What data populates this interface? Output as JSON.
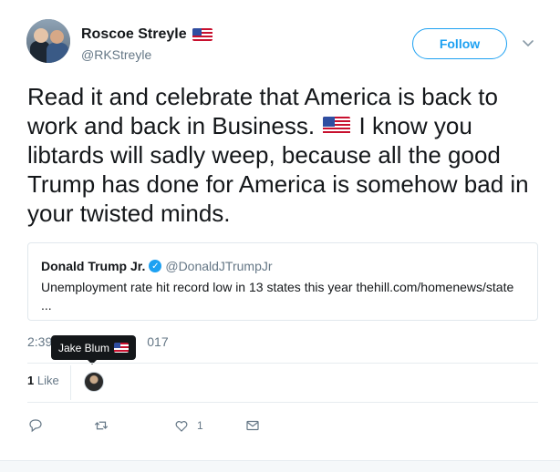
{
  "tweet": {
    "author": {
      "name": "Roscoe Streyle",
      "handle": "@RKStreyle",
      "name_emoji": "us-flag"
    },
    "follow_label": "Follow",
    "text": {
      "part1": "Read it and celebrate that America is back to work and back in Business.",
      "part2": "I know you libtards will sadly weep, because all the good Trump has done for America is somehow bad in your twisted minds."
    },
    "quoted": {
      "name": "Donald Trump Jr.",
      "handle": "@DonaldJTrumpJr",
      "text": "Unemployment rate hit record low in 13 states this year thehill.com/homenews/state",
      "ellipsis": "..."
    },
    "timestamp_start": "2:39",
    "timestamp_end": "017",
    "tooltip": {
      "name": "Jake Blum"
    },
    "likes": {
      "count": "1",
      "label": "Like"
    },
    "actions": {
      "reply_icon": "reply-icon",
      "retweet_icon": "retweet-icon",
      "like_icon": "heart-icon",
      "like_count": "1",
      "dm_icon": "envelope-icon"
    }
  },
  "colors": {
    "accent": "#1da1f2",
    "text": "#14171a",
    "secondary": "#657786",
    "border": "#e1e8ed",
    "flag_red": "#c8102e",
    "flag_blue": "#2f4ea1"
  }
}
